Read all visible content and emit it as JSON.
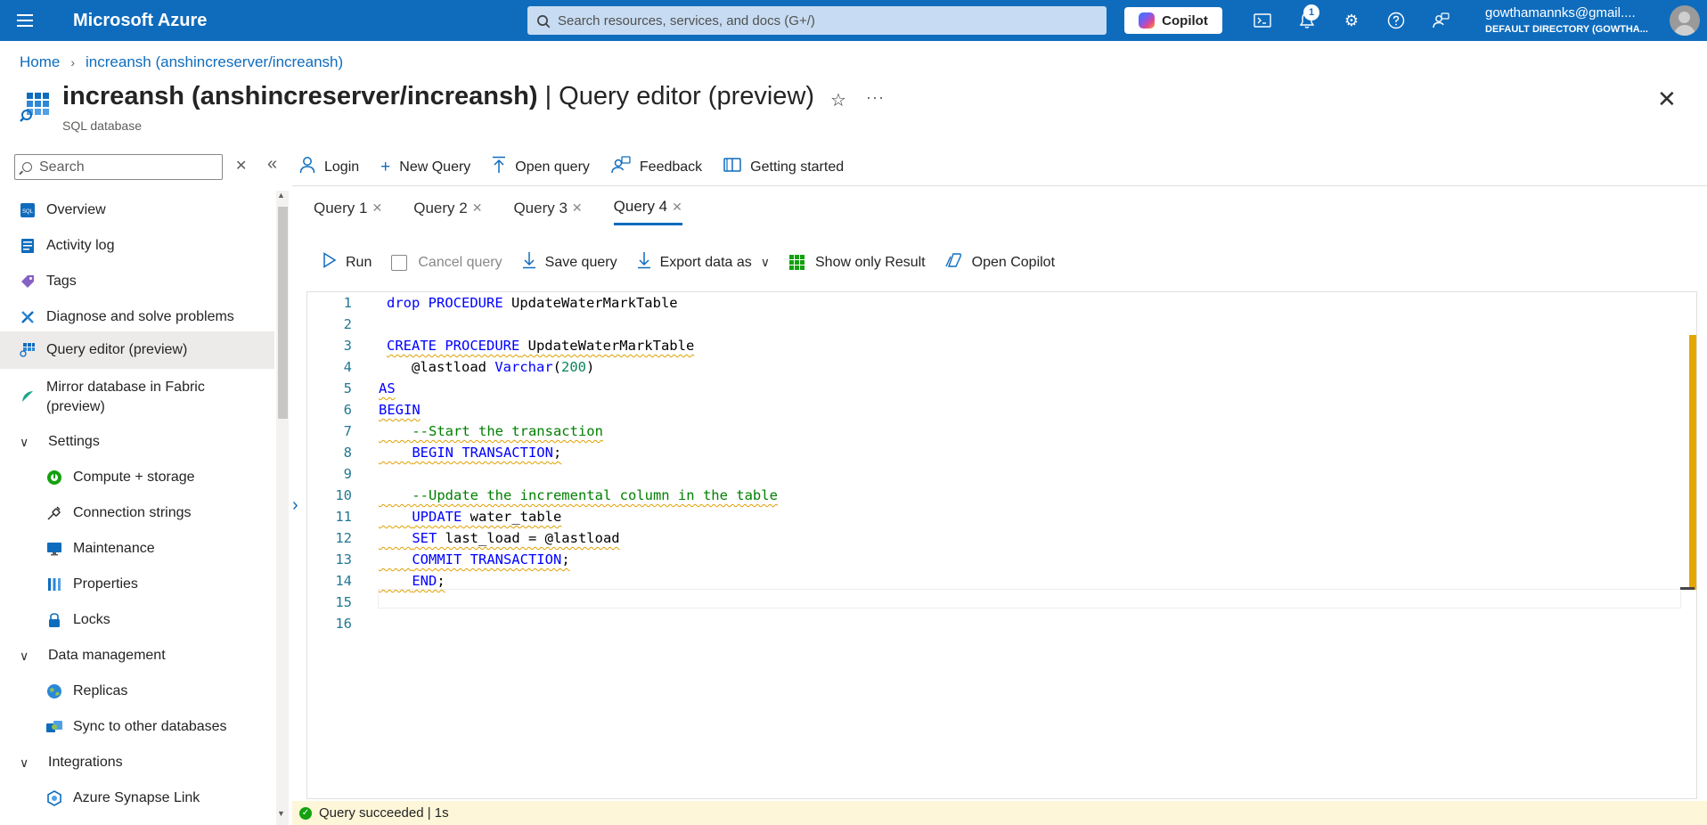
{
  "topbar": {
    "brand": "Microsoft Azure",
    "search_placeholder": "Search resources, services, and docs (G+/)",
    "copilot_label": "Copilot",
    "notification_count": "1",
    "user_name": "gowthamannks@gmail....",
    "user_directory": "DEFAULT DIRECTORY (GOWTHA..."
  },
  "breadcrumb": {
    "home": "Home",
    "current": "increansh (anshincreserver/increansh)"
  },
  "header": {
    "resource_name": "increansh (anshincreserver/increansh)",
    "blade_name": "| Query editor (preview)",
    "subtitle": "SQL database"
  },
  "sidebar": {
    "search_placeholder": "Search",
    "items": [
      {
        "label": "Overview"
      },
      {
        "label": "Activity log"
      },
      {
        "label": "Tags"
      },
      {
        "label": "Diagnose and solve problems"
      },
      {
        "label": "Query editor (preview)"
      },
      {
        "label": "Mirror database in Fabric"
      },
      {
        "label": "(preview)"
      },
      {
        "label": "Settings"
      },
      {
        "label": "Compute + storage"
      },
      {
        "label": "Connection strings"
      },
      {
        "label": "Maintenance"
      },
      {
        "label": "Properties"
      },
      {
        "label": "Locks"
      },
      {
        "label": "Data management"
      },
      {
        "label": "Replicas"
      },
      {
        "label": "Sync to other databases"
      },
      {
        "label": "Integrations"
      },
      {
        "label": "Azure Synapse Link"
      }
    ]
  },
  "commands": {
    "login": "Login",
    "new_query": "New Query",
    "open_query": "Open query",
    "feedback": "Feedback",
    "getting_started": "Getting started"
  },
  "query_tabs": [
    {
      "label": "Query 1"
    },
    {
      "label": "Query 2"
    },
    {
      "label": "Query 3"
    },
    {
      "label": "Query 4"
    }
  ],
  "editor_toolbar": {
    "run": "Run",
    "cancel_query": "Cancel query",
    "save_query": "Save query",
    "export_data_as": "Export data as",
    "show_only_result": "Show only Result",
    "open_copilot": "Open Copilot"
  },
  "editor": {
    "line_numbers": [
      "1",
      "2",
      "3",
      "4",
      "5",
      "6",
      "7",
      "8",
      "9",
      "10",
      "11",
      "12",
      "13",
      "14",
      "15",
      "16"
    ],
    "tokens": {
      "l1_kw": "drop PROCEDURE",
      "l1_name": " UpdateWaterMarkTable",
      "l3_kw": "CREATE PROCEDURE",
      "l3_name": " UpdateWaterMarkTable",
      "l4_param": "   @lastload ",
      "l4_type": "Varchar",
      "l4_open": "(",
      "l4_num": "200",
      "l4_close": ")",
      "l5": "AS",
      "l6": "BEGIN",
      "l7_comment": "    --Start the transaction",
      "l8_indent": "    ",
      "l8_kw": "BEGIN TRANSACTION",
      "l8_semi": ";",
      "l10_comment": "    --Update the incremental column in the table",
      "l11_indent": "    ",
      "l11_kw": "UPDATE",
      "l11_rest": " water_table",
      "l12_indent": "    ",
      "l12_kw": "SET",
      "l12_rest": " last_load = @lastload",
      "l13_indent": "    ",
      "l13_kw": "COMMIT TRANSACTION",
      "l13_semi": ";",
      "l14_indent": "    ",
      "l14_kw": "END",
      "l14_semi": ";"
    }
  },
  "status": {
    "message": "Query succeeded | 1s"
  },
  "colors": {
    "azure_blue": "#0f6cbd",
    "keyword_blue": "#0000ff",
    "comment_green": "#008000",
    "number_teal": "#098658",
    "warning_squiggle": "#e0a000",
    "status_bg": "#fdf6d8"
  }
}
